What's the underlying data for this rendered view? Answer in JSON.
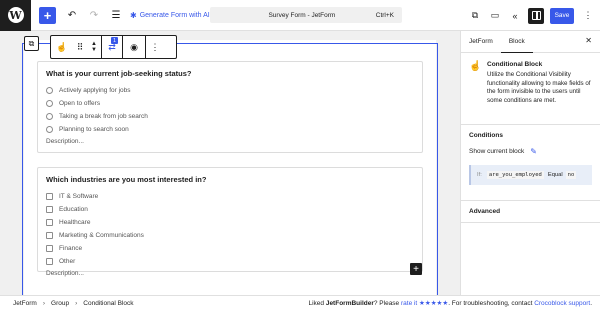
{
  "topbar": {
    "wp_logo_text": "W",
    "add_label": "+",
    "undo_icon": "undo-icon",
    "redo_icon": "redo-icon",
    "list_view_icon": "list-view-icon",
    "generate_label": "Generate Form with AI",
    "doc_title": "Survey Form - JetForm",
    "shortcut": "Ctrl+K",
    "save_label": "Save"
  },
  "block_toolbar": {
    "badge": "1"
  },
  "questions": [
    {
      "title": "What is your current job-seeking status?",
      "type": "radio",
      "options": [
        "Actively applying for jobs",
        "Open to offers",
        "Taking a break from job search",
        "Planning to search soon"
      ],
      "description": "Description..."
    },
    {
      "title": "Which industries are you most interested in?",
      "type": "checkbox",
      "options": [
        "IT & Software",
        "Education",
        "Healthcare",
        "Marketing & Communications",
        "Finance",
        "Other"
      ],
      "description": "Description..."
    }
  ],
  "sidebar": {
    "tabs": [
      "JetForm",
      "Block"
    ],
    "active_tab": "Block",
    "block_name": "Conditional Block",
    "block_desc": "Utilize the Conditional Visibility functionality allowing to make fields of the form invisible to the users until some conditions are met.",
    "conditions_heading": "Conditions",
    "show_label": "Show current block",
    "condition": {
      "if_label": "If:",
      "field": "are_you_employed",
      "operator": "Equal",
      "value": "no"
    },
    "advanced_heading": "Advanced"
  },
  "footer": {
    "breadcrumbs": [
      "JetForm",
      "Group",
      "Conditional Block"
    ],
    "liked_prefix": "Liked",
    "plugin": "JetFormBuilder",
    "please": "? Please",
    "rate_link": "rate it ★★★★★",
    "rest": ". For troubleshooting, contact",
    "support_link": "Crocoblock support",
    "end": "."
  },
  "colors": {
    "accent": "#3858e9",
    "dark": "#1e1e1e",
    "canvas_bg": "#f0f0f0",
    "condition_bg": "#e8eef8"
  }
}
